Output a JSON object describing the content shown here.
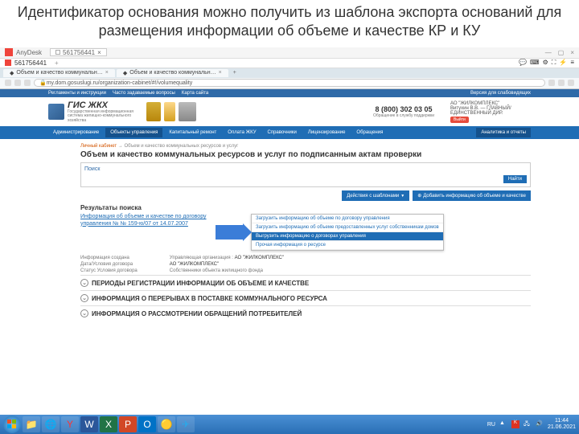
{
  "slide_title": "Идентификатор основания можно получить из шаблона экспорта оснований для размещения информации об объеме и качестве КР и КУ",
  "anydesk": {
    "name": "AnyDesk",
    "tab1": "561756441",
    "session": "561756441",
    "plus": "+"
  },
  "browser": {
    "tabs": [
      "Объем и качество коммунальн…",
      "Объем и качество коммунальн…"
    ],
    "url": "my.dom.gosuslugi.ru/organization-cabinet/#!/volumequality"
  },
  "portal_top": [
    "Регламенты и инструкции",
    "Часто задаваемые вопросы",
    "Карта сайта",
    "Версия для слабовидящих"
  ],
  "logo": {
    "title": "ГИС ЖКХ",
    "sub": "Государственная информационная система жилищно-коммунального хозяйства"
  },
  "phone": {
    "number": "8 (800) 302 03 05",
    "sub": "Обращение в службу поддержки"
  },
  "user": {
    "org": "АО \"ЖИЛКОМПЛЕКС\"",
    "info": "Витухин В.В. — ГЛАВНЫЙ/ЕДИНСТВЕННЫЙ ДИР.",
    "btn": "Выйти"
  },
  "nav": [
    "Администрирование",
    "Объекты управления",
    "Капитальный ремонт",
    "Оплата ЖКУ",
    "Справочники",
    "Лицензирование",
    "Обращения",
    "Аналитика и отчеты"
  ],
  "crumb": {
    "a": "Личный кабинет",
    "b": "Объем и качество коммунальных ресурсов и услуг"
  },
  "page_title": "Объем и качество коммунальных ресурсов и услуг по подписанным актам проверки",
  "search": {
    "label": "Поиск",
    "button": "Найти"
  },
  "actions": {
    "templates": "Действия с шаблонами",
    "add": "Добавить информацию об объеме и качестве"
  },
  "results_header": "Результаты поиска",
  "result_link": "Информация об объеме и качестве по договору управления № № 159-ю/07 от 14.07.2007",
  "dropdown": [
    "Загрузить информацию об объеме по договору управления",
    "Загрузить информацию об объеме предоставленных услуг собственникам домов",
    "Выгрузить информацию о договорах управления",
    "Прочая информация о ресурсе"
  ],
  "info": {
    "left": [
      "Информация создана",
      "Дата/Условия договора",
      "Статус Условия договора"
    ],
    "right_labels": [
      "Управляющая организация :",
      "",
      "Собственники объекта жилищного фонда"
    ],
    "right_vals": [
      "АО \"ЖИЛКОМПЛЕКС\"",
      "АО \"ЖИЛКОМПЛЕКС\"",
      ""
    ]
  },
  "expanders": [
    "ПЕРИОДЫ РЕГИСТРАЦИИ ИНФОРМАЦИИ ОБ ОБЪЕМЕ И КАЧЕСТВЕ",
    "ИНФОРМАЦИЯ О ПЕРЕРЫВАХ В ПОСТАВКЕ КОММУНАЛЬНОГО РЕСУРСА",
    "ИНФОРМАЦИЯ О РАССМОТРЕНИИ ОБРАЩЕНИЙ ПОТРЕБИТЕЛЕЙ"
  ],
  "taskbar": {
    "lang": "RU",
    "time": "11:44",
    "date": "21.06.2021"
  }
}
